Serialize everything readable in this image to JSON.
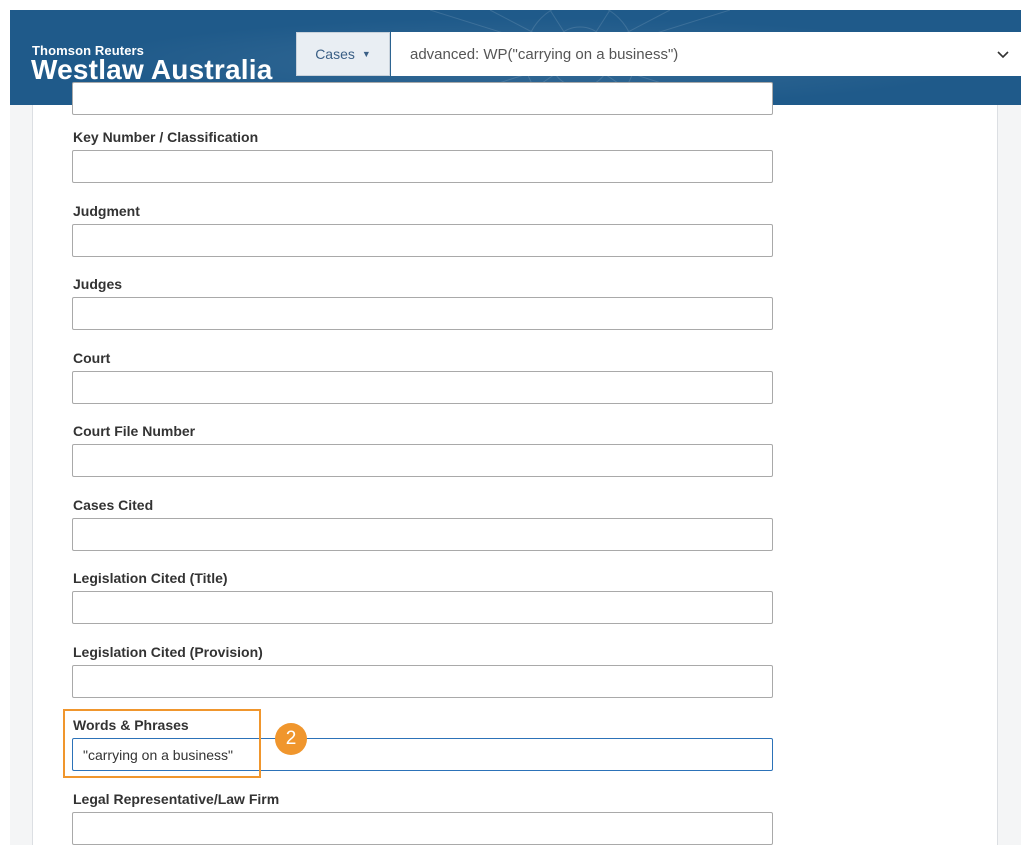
{
  "header": {
    "brand_small": "Thomson Reuters",
    "brand_big": "Westlaw Australia",
    "cases_label": "Cases",
    "search_value": "advanced: WP(\"carrying on a business\")",
    "accent_color": "#1f5a8a"
  },
  "form": {
    "fields": [
      {
        "label": "",
        "value": ""
      },
      {
        "label": "Key Number / Classification",
        "value": ""
      },
      {
        "label": "Judgment",
        "value": ""
      },
      {
        "label": "Judges",
        "value": ""
      },
      {
        "label": "Court",
        "value": ""
      },
      {
        "label": "Court File Number",
        "value": ""
      },
      {
        "label": "Cases Cited",
        "value": ""
      },
      {
        "label": "Legislation Cited (Title)",
        "value": ""
      },
      {
        "label": "Legislation Cited (Provision)",
        "value": ""
      },
      {
        "label": "Words & Phrases",
        "value": "\"carrying on a business\""
      },
      {
        "label": "Legal Representative/Law Firm",
        "value": ""
      }
    ]
  },
  "annotation": {
    "step_number": "2",
    "highlight_color": "#f0962d"
  },
  "icons": {
    "cases_caret": "caret-down-icon",
    "search_dropdown": "chevron-down-icon"
  }
}
